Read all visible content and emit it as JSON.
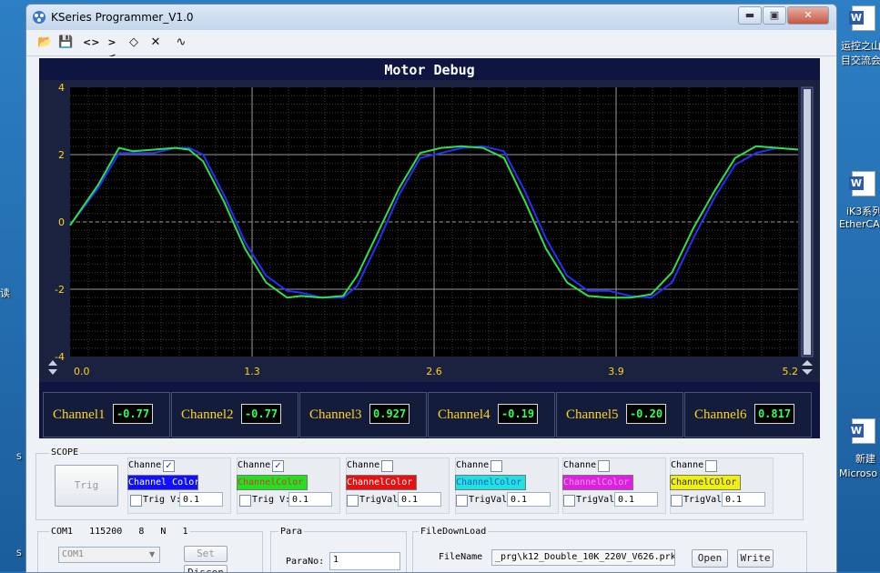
{
  "window": {
    "title": "KSeries Programmer_V1.0",
    "minimize_label": "▬",
    "restore_label": "▣",
    "close_label": "✕"
  },
  "desktop": {
    "items": [
      "运控之山",
      "目交流会",
      "iK3系列",
      "EtherCA",
      "新建",
      "Microso"
    ],
    "left_text": [
      "读",
      "S",
      "S"
    ]
  },
  "toolbar": {
    "icons": [
      "open-folder-icon",
      "save-icon",
      "expand-horizontal-icon",
      "shrink-horizontal-icon",
      "expand-vertical-icon",
      "shrink-both-icon",
      "waveform-icon"
    ],
    "glyphs": [
      "📂",
      "💾",
      "<>",
      "><",
      "◇",
      "✕",
      "∿"
    ]
  },
  "scope": {
    "title": "Motor Debug"
  },
  "chart_data": {
    "type": "line",
    "title": "Motor Debug",
    "xlabel": "",
    "ylabel": "",
    "xlim": [
      0,
      5.2
    ],
    "ylim": [
      -4,
      4
    ],
    "x_ticks": [
      "0.0",
      "1.3",
      "2.6",
      "3.9",
      "5.2"
    ],
    "y_ticks": [
      "4",
      "2",
      "0",
      "-2",
      "-4"
    ],
    "grid": true,
    "series": [
      {
        "color": "#2330ff",
        "x": [
          0,
          0.2,
          0.35,
          0.45,
          0.6,
          0.75,
          0.85,
          0.95,
          1.1,
          1.25,
          1.4,
          1.55,
          1.65,
          1.8,
          1.95,
          2.05,
          2.2,
          2.35,
          2.5,
          2.65,
          2.8,
          2.95,
          3.1,
          3.25,
          3.4,
          3.55,
          3.7,
          3.85,
          4.0,
          4.15,
          4.3,
          4.45,
          4.6,
          4.75,
          4.9,
          5.05,
          5.2
        ],
        "y": [
          -0.1,
          1.0,
          2.05,
          2.05,
          2.05,
          2.2,
          2.2,
          2.0,
          0.8,
          -0.6,
          -1.6,
          -2.05,
          -2.1,
          -2.25,
          -2.25,
          -1.9,
          -0.6,
          0.8,
          1.9,
          2.05,
          2.2,
          2.25,
          2.1,
          0.9,
          -0.5,
          -1.6,
          -2.05,
          -2.05,
          -2.2,
          -2.25,
          -1.8,
          -0.5,
          0.7,
          1.7,
          2.05,
          2.2,
          2.15
        ]
      },
      {
        "color": "#2fe04a",
        "x": [
          0,
          0.2,
          0.35,
          0.45,
          0.6,
          0.75,
          0.85,
          0.95,
          1.1,
          1.25,
          1.4,
          1.55,
          1.65,
          1.8,
          1.95,
          2.05,
          2.2,
          2.35,
          2.5,
          2.65,
          2.8,
          2.95,
          3.1,
          3.25,
          3.4,
          3.55,
          3.7,
          3.85,
          4.0,
          4.15,
          4.3,
          4.45,
          4.6,
          4.75,
          4.9,
          5.05,
          5.2
        ],
        "y": [
          -0.1,
          1.1,
          2.2,
          2.1,
          2.15,
          2.2,
          2.15,
          1.8,
          0.6,
          -0.8,
          -1.8,
          -2.25,
          -2.2,
          -2.25,
          -2.2,
          -1.6,
          -0.3,
          1.0,
          2.05,
          2.2,
          2.25,
          2.2,
          1.9,
          0.6,
          -0.8,
          -1.8,
          -2.2,
          -2.25,
          -2.25,
          -2.15,
          -1.5,
          -0.2,
          0.9,
          1.9,
          2.25,
          2.2,
          2.15
        ]
      }
    ]
  },
  "channels": [
    {
      "label": "Channel1",
      "value": "-0.77"
    },
    {
      "label": "Channel2",
      "value": "-0.77"
    },
    {
      "label": "Channel3",
      "value": "0.927"
    },
    {
      "label": "Channel4",
      "value": "-0.19"
    },
    {
      "label": "Channel5",
      "value": "-0.20"
    },
    {
      "label": "Channel6",
      "value": "0.817"
    }
  ],
  "scope_panel": {
    "label": "SCOPE",
    "trig_button": "Trig",
    "channels": [
      {
        "label": "Channe",
        "checked": "✓",
        "color_label": "Channel Color",
        "color": "#1010ff",
        "text_color": "#fff",
        "trig_label": "Trig V:",
        "trig_value": "0.1"
      },
      {
        "label": "Channe",
        "checked": "✓",
        "color_label": "ChannelColor",
        "color": "#22e022",
        "text_color": "#e03030",
        "trig_label": "Trig V:",
        "trig_value": "0.1"
      },
      {
        "label": "Channe",
        "checked": "",
        "color_label": "ChannelColor",
        "color": "#e81010",
        "text_color": "#ffffff",
        "trig_label": "TrigVal",
        "trig_value": "0.1"
      },
      {
        "label": "Channe",
        "checked": "",
        "color_label": "ChannelColor",
        "color": "#22e0e0",
        "text_color": "#1060c0",
        "trig_label": "TrigVal",
        "trig_value": "0.1"
      },
      {
        "label": "Channe",
        "checked": "",
        "color_label": "ChannelColor",
        "color": "#e020e0",
        "text_color": "#f0a0f0",
        "trig_label": "TrigVal",
        "trig_value": "0.1"
      },
      {
        "label": "Channe",
        "checked": "",
        "color_label": "ChannelCOlor",
        "color": "#f0f010",
        "text_color": "#333333",
        "trig_label": "TrigVal",
        "trig_value": "0.1"
      }
    ]
  },
  "com": {
    "label": "COM1   115200   8   N   1",
    "port_value": "COM1",
    "set_button": "Set",
    "disconnect_button": "Discon"
  },
  "para": {
    "label": "Para",
    "para_no_label": "ParaNo:",
    "para_no_value": "1"
  },
  "download": {
    "label": "FileDownLoad",
    "file_name_label": "FileName",
    "file_name_value": "_prg\\k12_Double_10K_220V_V626.prk",
    "open_button": "Open",
    "write_button": "Write"
  }
}
